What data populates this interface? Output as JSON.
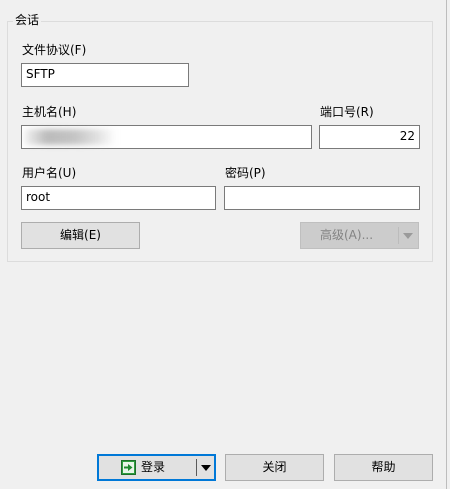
{
  "session": {
    "group_title": "会话",
    "protocol": {
      "label": "文件协议(F)",
      "value": "SFTP"
    },
    "host": {
      "label": "主机名(H)",
      "value": ""
    },
    "port": {
      "label": "端口号(R)",
      "value": "22"
    },
    "username": {
      "label": "用户名(U)",
      "value": "root"
    },
    "password": {
      "label": "密码(P)",
      "value": ""
    },
    "edit_button": "编辑(E)",
    "advanced_button": "高级(A)..."
  },
  "footer": {
    "login_button": "登录",
    "close_button": "关闭",
    "help_button": "帮助"
  },
  "icons": {
    "login": "login-arrow-icon",
    "dropdown": "chevron-down-icon"
  },
  "colors": {
    "background": "#f0f0f0",
    "focus_border": "#0078d7",
    "login_icon": "#2e9e3e"
  }
}
